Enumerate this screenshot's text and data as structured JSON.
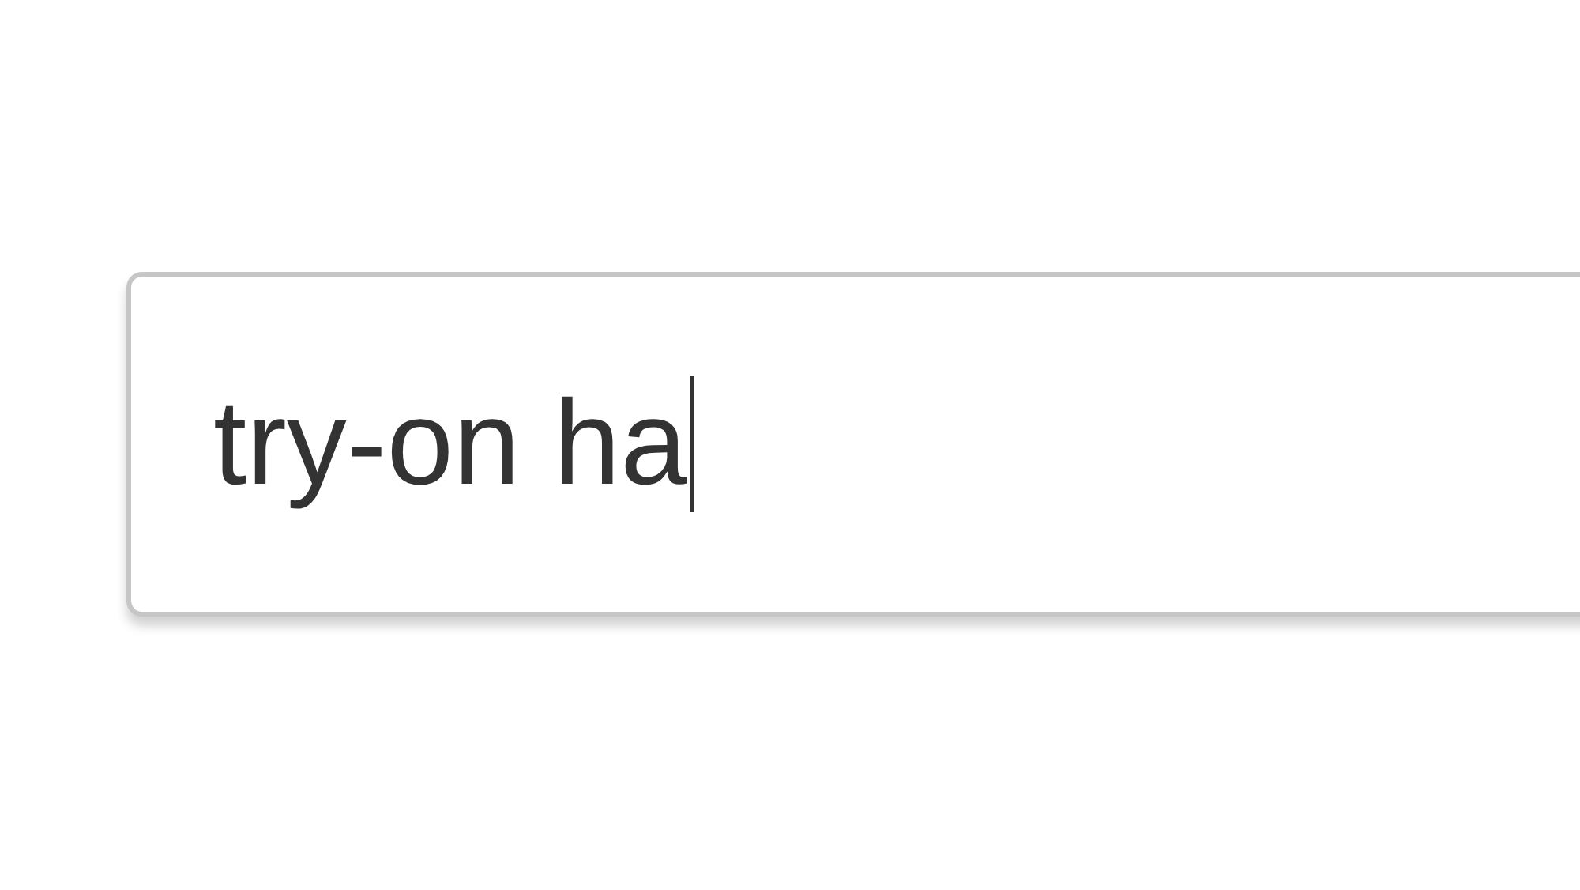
{
  "search_field": {
    "value": "try-on ha",
    "focused": true
  }
}
